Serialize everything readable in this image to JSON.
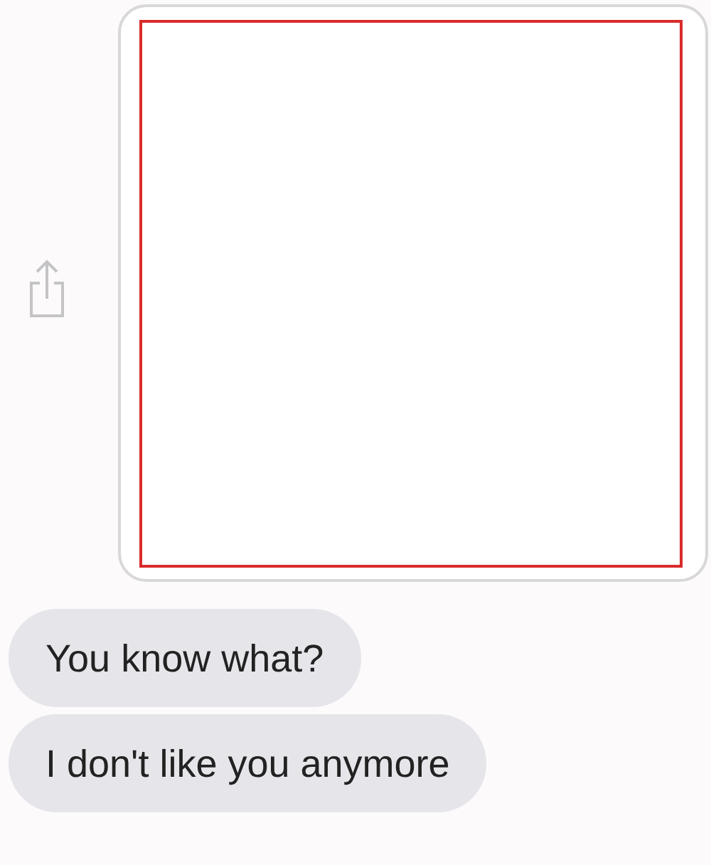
{
  "attachment": {
    "kind": "image"
  },
  "messages": [
    {
      "kind": "text",
      "text": "You know what?"
    },
    {
      "kind": "text",
      "text": "I don't like you anymore"
    }
  ]
}
